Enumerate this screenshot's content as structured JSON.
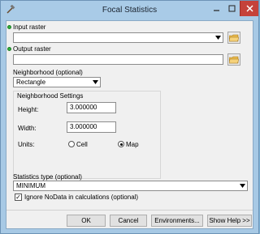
{
  "window": {
    "title": "Focal Statistics"
  },
  "input_raster": {
    "label": "Input raster",
    "value": ""
  },
  "output_raster": {
    "label": "Output raster",
    "value": ""
  },
  "neighborhood": {
    "label": "Neighborhood (optional)",
    "selected": "Rectangle"
  },
  "neighborhood_settings": {
    "title": "Neighborhood Settings",
    "height_label": "Height:",
    "height_value": "3.000000",
    "width_label": "Width:",
    "width_value": "3.000000",
    "units_label": "Units:",
    "units_options": [
      "Cell",
      "Map"
    ],
    "units_selected": "Map"
  },
  "statistics_type": {
    "label": "Statistics type (optional)",
    "selected": "MINIMUM"
  },
  "ignore_nodata": {
    "label": "Ignore NoData in calculations (optional)",
    "checked": true
  },
  "buttons": {
    "ok": "OK",
    "cancel": "Cancel",
    "environments": "Environments...",
    "show_help": "Show Help >>"
  },
  "colors": {
    "required_dot": "#2fb33a",
    "close_button": "#c5423a",
    "title_bar": "#a9cbe7"
  },
  "icons": {
    "app": "hammer-icon",
    "browse": "folder-icon",
    "minimize": "minimize-icon",
    "maximize": "maximize-icon",
    "close": "close-icon"
  }
}
